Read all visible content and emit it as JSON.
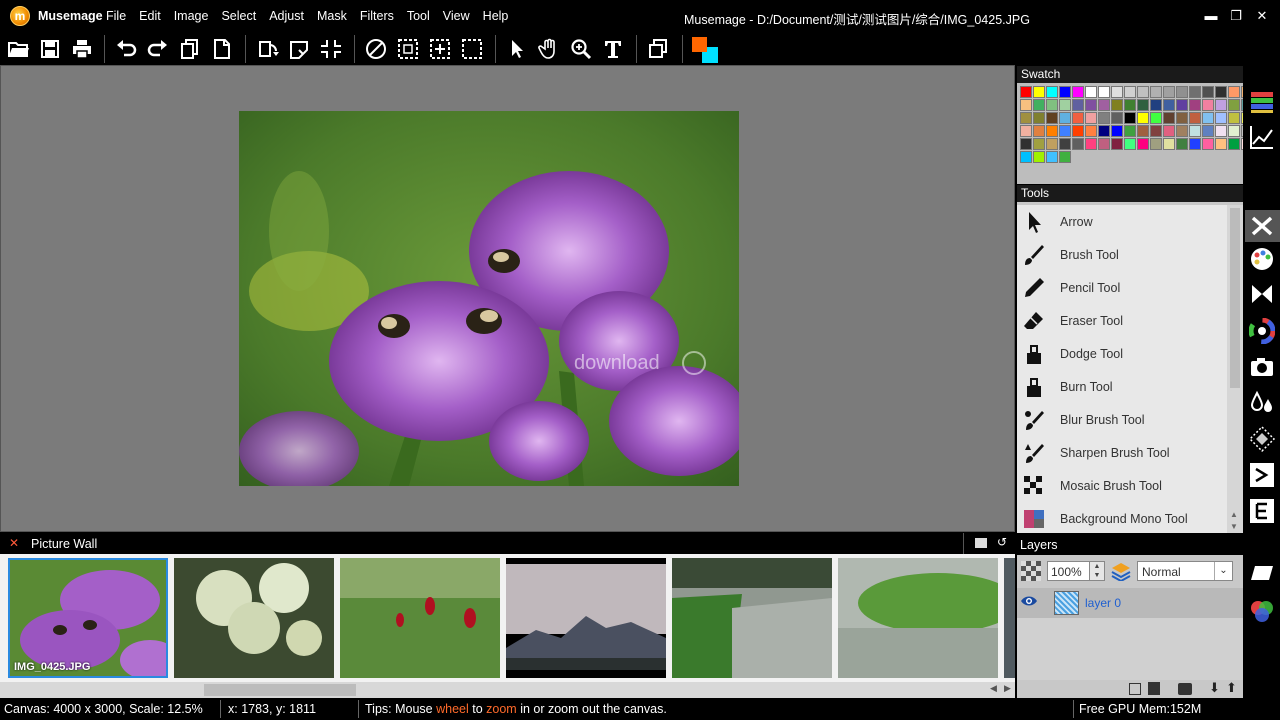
{
  "app": {
    "name": "Musemage",
    "logo_letter": "m",
    "window_title": "Musemage - D:/Document/测试/测试图片/综合/IMG_0425.JPG"
  },
  "menu": [
    "File",
    "Edit",
    "Image",
    "Select",
    "Adjust",
    "Mask",
    "Filters",
    "Tool",
    "View",
    "Help"
  ],
  "window_controls": {
    "minimize": "▬",
    "maximize": "❐",
    "close": "✕"
  },
  "toolbar": {
    "icons": [
      "open-folder-icon",
      "save-icon",
      "print-icon",
      "undo-icon",
      "redo-icon",
      "copy-icon",
      "new-page-icon",
      "rotate-icon",
      "transform-icon",
      "crop-icon",
      "no-selection-icon",
      "rect-select-icon",
      "move-select-icon",
      "lasso-select-icon",
      "arrow-icon",
      "hand-icon",
      "zoom-icon",
      "text-icon",
      "layers-icon",
      "color-swatch-icon"
    ],
    "foreground_color": "#ff6600",
    "background_color": "#00e0ff"
  },
  "swatch": {
    "title": "Swatch",
    "colors": [
      "#ff0000",
      "#ffff00",
      "#00ffff",
      "#0000ff",
      "#ff00ff",
      "#ffffff",
      "#ffffff",
      "#e0e0e0",
      "#d0d0d0",
      "#c0c0c0",
      "#b0b0b0",
      "#a0a0a0",
      "#909090",
      "#707070",
      "#505050",
      "#303030",
      "#ff9966",
      "#f0b070",
      "#f8c080",
      "#40b060",
      "#80c080",
      "#a0d0a0",
      "#6060a0",
      "#8050a0",
      "#a060a0",
      "#808020",
      "#408030",
      "#306040",
      "#204080",
      "#4060a0",
      "#6040a0",
      "#a04080",
      "#f080a0",
      "#c0a0e0",
      "#80a040",
      "#60a0a0",
      "#a09040",
      "#808030",
      "#604020",
      "#60b0e0",
      "#f06040",
      "#f0a0a0",
      "#808080",
      "#606060",
      "#000000",
      "#ffff00",
      "#40ff40",
      "#604030",
      "#806040",
      "#c06040",
      "#80c0f0",
      "#a0c0ff",
      "#c0c040",
      "#f0f060",
      "#f0b0a0",
      "#e08040",
      "#ff8000",
      "#4080ff",
      "#ff4000",
      "#ff8040",
      "#000080",
      "#0000ff",
      "#40a040",
      "#a06040",
      "#804040",
      "#e06080",
      "#a08060",
      "#c0e0e0",
      "#6080c0",
      "#f0e0f0",
      "#e0f0d0",
      "#c0c0c0",
      "#303030",
      "#a0a040",
      "#c0a060",
      "#404040",
      "#606060",
      "#ff4080",
      "#c06080",
      "#802040",
      "#40ff80",
      "#ff0080",
      "#a0a080",
      "#e0e0a0",
      "#408040",
      "#2040ff",
      "#ff60a0",
      "#ffc080",
      "#00a040",
      "#ffe0e0",
      "#00c0ff",
      "#a0f000",
      "#40c0ff",
      "#40b040"
    ]
  },
  "tools": {
    "title": "Tools",
    "items": [
      {
        "label": "Arrow",
        "icon": "arrow-icon"
      },
      {
        "label": "Brush Tool",
        "icon": "brush-icon"
      },
      {
        "label": "Pencil Tool",
        "icon": "pencil-icon"
      },
      {
        "label": "Eraser Tool",
        "icon": "eraser-icon"
      },
      {
        "label": "Dodge Tool",
        "icon": "dodge-icon"
      },
      {
        "label": "Burn Tool",
        "icon": "burn-icon"
      },
      {
        "label": "Blur Brush Tool",
        "icon": "blur-brush-icon"
      },
      {
        "label": "Sharpen Brush Tool",
        "icon": "sharpen-brush-icon"
      },
      {
        "label": "Mosaic Brush Tool",
        "icon": "mosaic-brush-icon"
      },
      {
        "label": "Background Mono Tool",
        "icon": "background-mono-icon"
      }
    ]
  },
  "side_panel_icons": [
    "histogram-icon",
    "curves-icon",
    "tools-icon",
    "palette-icon",
    "butterfly-icon",
    "color-wheel-icon",
    "camera-icon",
    "drops-icon",
    "pattern-icon",
    "arrow-right-icon",
    "e-icon"
  ],
  "layers": {
    "title": "Layers",
    "opacity": "100%",
    "blend_mode": "Normal",
    "items": [
      {
        "name": "layer 0",
        "visible": true
      }
    ]
  },
  "picture_wall": {
    "title": "Picture Wall",
    "selected_label": "IMG_0425.JPG",
    "thumbnails": [
      "thistle-bees",
      "white-flowers",
      "red-flowers",
      "mountain-dusk",
      "lake-shore",
      "lake-grass"
    ]
  },
  "canvas": {
    "watermark": "download"
  },
  "status": {
    "canvas_info": "Canvas: 4000 x 3000, Scale: 12.5%",
    "coords": "x: 1783, y: 1811",
    "tip_prefix": "Tips: Mouse ",
    "tip_wheel": "wheel",
    "tip_to": " to ",
    "tip_zoom": "zoom",
    "tip_suffix": " in or zoom out the canvas.",
    "gpu_mem": "Free GPU Mem:152M"
  }
}
